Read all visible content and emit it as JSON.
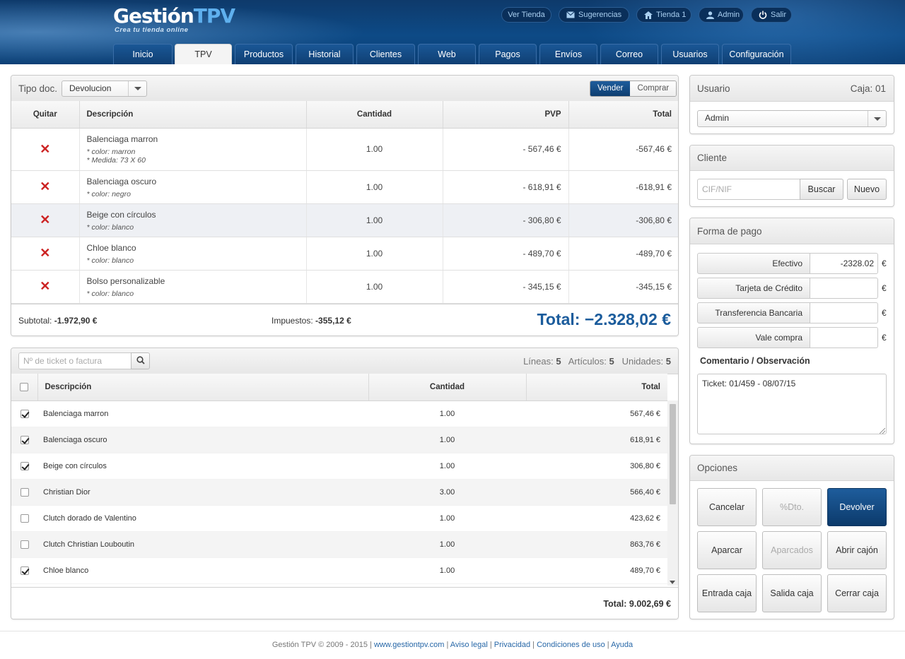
{
  "brand": {
    "name_a": "Gestión",
    "name_b": "TPV",
    "tagline": "Crea tu tienda online"
  },
  "toplinks": [
    {
      "label": "Ver Tienda",
      "icon": ""
    },
    {
      "label": "Sugerencias",
      "icon": "mail-icon"
    },
    {
      "label": "Tienda 1",
      "icon": "home-icon"
    },
    {
      "label": "Admin",
      "icon": "user-icon"
    },
    {
      "label": "Salir",
      "icon": "power-icon"
    }
  ],
  "tabs": [
    "Inicio",
    "TPV",
    "Productos",
    "Historial",
    "Clientes",
    "Web",
    "Pagos",
    "Envíos",
    "Correo",
    "Usuarios",
    "Configuración"
  ],
  "active_tab": "TPV",
  "ticket": {
    "doc_label": "Tipo doc.",
    "doc_value": "Devolucion",
    "mode_sell": "Vender",
    "mode_buy": "Comprar",
    "columns": {
      "remove": "Quitar",
      "desc": "Descripción",
      "qty": "Cantidad",
      "pvp": "PVP",
      "total": "Total"
    },
    "rows": [
      {
        "name": "Balenciaga marron",
        "opts": [
          "* color: marron",
          "* Medida: 73 X 60"
        ],
        "qty": "1.00",
        "pvp": "- 567,46 €",
        "total": "-567,46 €"
      },
      {
        "name": "Balenciaga oscuro",
        "opts": [
          "* color: negro"
        ],
        "qty": "1.00",
        "pvp": "- 618,91 €",
        "total": "-618,91 €"
      },
      {
        "name": "Beige con círculos",
        "opts": [
          "* color: blanco"
        ],
        "qty": "1.00",
        "pvp": "- 306,80 €",
        "total": "-306,80 €"
      },
      {
        "name": "Chloe blanco",
        "opts": [
          "* color: blanco"
        ],
        "qty": "1.00",
        "pvp": "- 489,70 €",
        "total": "-489,70 €"
      },
      {
        "name": "Bolso personalizable",
        "opts": [
          "* color: blanco"
        ],
        "qty": "1.00",
        "pvp": "- 345,15 €",
        "total": "-345,15 €"
      }
    ],
    "subtotal_label": "Subtotal:",
    "subtotal": "-1.972,90 €",
    "tax_label": "Impuestos:",
    "tax": "-355,12 €",
    "total_label": "Total:",
    "total": "−2.328,02 €"
  },
  "lookup": {
    "placeholder": "Nº de ticket o factura",
    "lines_label": "Líneas:",
    "lines": "5",
    "items_label": "Artículos:",
    "items": "5",
    "units_label": "Unidades:",
    "units": "5",
    "columns": {
      "desc": "Descripción",
      "qty": "Cantidad",
      "total": "Total"
    },
    "rows": [
      {
        "checked": true,
        "name": "Balenciaga marron",
        "qty": "1.00",
        "total": "567,46 €"
      },
      {
        "checked": true,
        "name": "Balenciaga oscuro",
        "qty": "1.00",
        "total": "618,91 €"
      },
      {
        "checked": true,
        "name": "Beige con círculos",
        "qty": "1.00",
        "total": "306,80 €"
      },
      {
        "checked": false,
        "name": "Christian Dior",
        "qty": "3.00",
        "total": "566,40 €"
      },
      {
        "checked": false,
        "name": "Clutch dorado de Valentino",
        "qty": "1.00",
        "total": "423,62 €"
      },
      {
        "checked": false,
        "name": "Clutch Christian Louboutin",
        "qty": "1.00",
        "total": "863,76 €"
      },
      {
        "checked": true,
        "name": "Chloe blanco",
        "qty": "1.00",
        "total": "489,70 €"
      }
    ],
    "total": "Total: 9.002,69 €"
  },
  "user_panel": {
    "title": "Usuario",
    "caja": "Caja: 01",
    "selected": "Admin"
  },
  "client_panel": {
    "title": "Cliente",
    "placeholder": "CIF/NIF",
    "search": "Buscar",
    "new": "Nuevo"
  },
  "payment": {
    "title": "Forma de pago",
    "methods": [
      {
        "label": "Efectivo",
        "value": "-2328.02"
      },
      {
        "label": "Tarjeta de Crédito",
        "value": ""
      },
      {
        "label": "Transferencia Bancaria",
        "value": ""
      },
      {
        "label": "Vale compra",
        "value": ""
      }
    ],
    "currency": "€",
    "comment_label": "Comentario / Observación",
    "comment": "Ticket: 01/459 - 08/07/15"
  },
  "options": {
    "title": "Opciones",
    "buttons": [
      {
        "label": "Cancelar",
        "state": "normal"
      },
      {
        "label": "%Dto.",
        "state": "disabled"
      },
      {
        "label": "Devolver",
        "state": "primary"
      },
      {
        "label": "Aparcar",
        "state": "normal"
      },
      {
        "label": "Aparcados",
        "state": "disabled"
      },
      {
        "label": "Abrir cajón",
        "state": "normal"
      },
      {
        "label": "Entrada caja",
        "state": "normal"
      },
      {
        "label": "Salida caja",
        "state": "normal"
      },
      {
        "label": "Cerrar caja",
        "state": "normal"
      }
    ]
  },
  "footer": {
    "copyright": "Gestión TPV © 2009 - 2015 |",
    "links": [
      "www.gestiontpv.com",
      "Aviso legal",
      "Privacidad",
      "Condiciones de uso",
      "Ayuda"
    ]
  }
}
